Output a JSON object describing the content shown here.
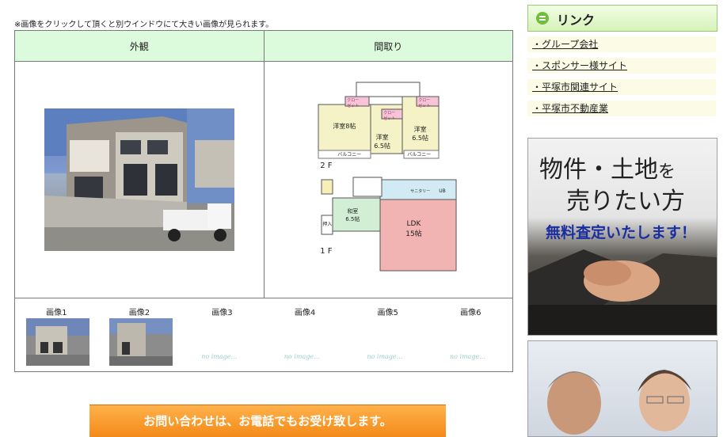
{
  "note": "※画像をクリックして頂くと別ウインドウにて大きい画像が見られます。",
  "table": {
    "col1_header": "外観",
    "col2_header": "間取り"
  },
  "floorplan": {
    "closet1": "クロー\nゼット",
    "closet2": "クロー\nゼット",
    "closet3": "クロー\nゼット",
    "room1": "洋室8帖",
    "room2": "洋室\n6.5帖",
    "room3": "洋室\n6.5帖",
    "balcony1": "バルコニー",
    "balcony2": "バルコニー",
    "floor2": "2 F",
    "floor1": "1 F",
    "japanese_room": "和室\n6.5帖",
    "ldk": "LDK\n15帖",
    "storage": "押入",
    "bath": "UB",
    "sanitary": "サニタリー"
  },
  "thumbnails": [
    {
      "label": "画像1",
      "has_image": true
    },
    {
      "label": "画像2",
      "has_image": true
    },
    {
      "label": "画像3",
      "has_image": false,
      "placeholder": "no image..."
    },
    {
      "label": "画像4",
      "has_image": false,
      "placeholder": "no image..."
    },
    {
      "label": "画像5",
      "has_image": false,
      "placeholder": "no image..."
    },
    {
      "label": "画像6",
      "has_image": false,
      "placeholder": "no image..."
    }
  ],
  "contact_banner": "お問い合わせは、お電話でもお受け致します。",
  "sidebar": {
    "links_title": "リンク",
    "links": [
      "・グループ会社",
      "・スポンサー様サイト",
      "・平塚市関連サイト",
      "・平塚市不動産業"
    ],
    "ad_sell": {
      "line1_a": "物件・土地",
      "line1_b": "を",
      "line2": "売りたい方",
      "line3": "無料査定いたします！"
    }
  },
  "colors": {
    "header_green": "#dcfadc",
    "link_bg": "#fbfbe6",
    "banner_orange": "#f59a2a",
    "ad_blue_text": "#1a2e9e"
  }
}
